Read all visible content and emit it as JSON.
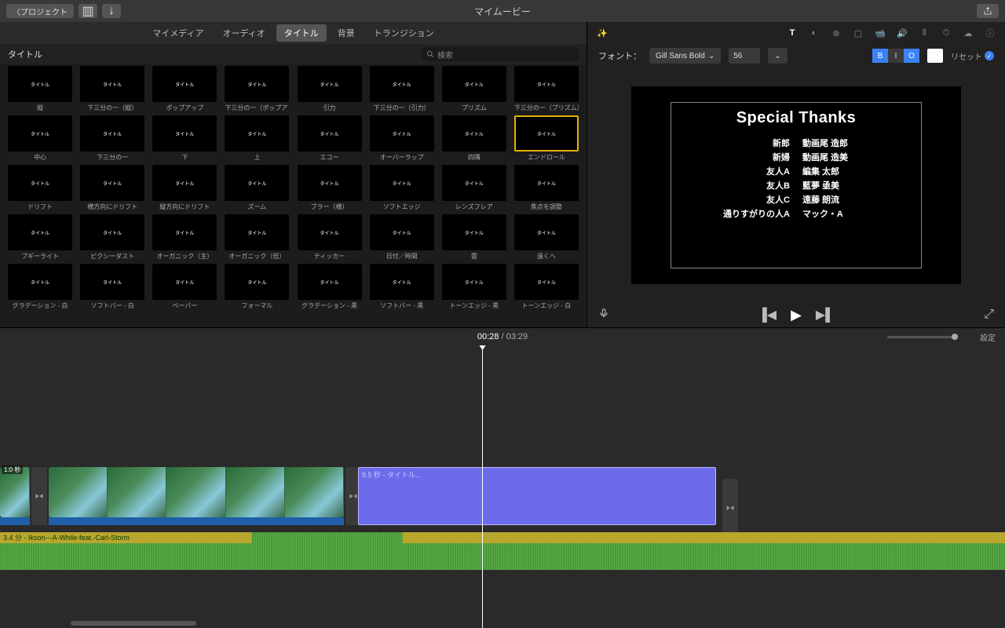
{
  "app": {
    "title": "マイムービー",
    "back": "プロジェクト"
  },
  "browser": {
    "tabs": [
      "マイメディア",
      "オーディオ",
      "タイトル",
      "背景",
      "トランジション"
    ],
    "activeTab": 2,
    "section": "タイトル",
    "search_placeholder": "検索",
    "titles": [
      {
        "label": "縦"
      },
      {
        "label": "下三分の一（縦）"
      },
      {
        "label": "ポップアップ"
      },
      {
        "label": "下三分の一（ポップアップ）"
      },
      {
        "label": "引力"
      },
      {
        "label": "下三分の一（引力）"
      },
      {
        "label": "プリズム"
      },
      {
        "label": "下三分の一（プリズム）"
      },
      {
        "label": "中心"
      },
      {
        "label": "下三分の一"
      },
      {
        "label": "下"
      },
      {
        "label": "上"
      },
      {
        "label": "エコー"
      },
      {
        "label": "オーバーラップ"
      },
      {
        "label": "四隅"
      },
      {
        "label": "エンドロール",
        "selected": true
      },
      {
        "label": "ドリフト"
      },
      {
        "label": "横方向にドリフト"
      },
      {
        "label": "縦方向にドリフト"
      },
      {
        "label": "ズーム"
      },
      {
        "label": "ブラー（横）"
      },
      {
        "label": "ソフトエッジ"
      },
      {
        "label": "レンズフレア"
      },
      {
        "label": "焦点を調整"
      },
      {
        "label": "ブギーライト"
      },
      {
        "label": "ピクシーダスト"
      },
      {
        "label": "オーガニック（主）"
      },
      {
        "label": "オーガニック（低）"
      },
      {
        "label": "ティッカー"
      },
      {
        "label": "日付／時間"
      },
      {
        "label": "雲"
      },
      {
        "label": "遠くへ"
      },
      {
        "label": "グラデーション - 白"
      },
      {
        "label": "ソフトバー - 白"
      },
      {
        "label": "ペーパー"
      },
      {
        "label": "フォーマル"
      },
      {
        "label": "グラデーション - 黒"
      },
      {
        "label": "ソフトバー - 黒"
      },
      {
        "label": "トーンエッジ - 黒"
      },
      {
        "label": "トーンエッジ - 白"
      }
    ]
  },
  "inspector": {
    "font_label": "フォント：",
    "font_family": "Gill Sans Bold",
    "font_size": "56",
    "bold": "B",
    "italic": "I",
    "outline": "O",
    "reset": "リセット"
  },
  "credits": {
    "heading": "Special Thanks",
    "rows": [
      {
        "role": "新郎",
        "name": "動画尾 造郎"
      },
      {
        "role": "新婦",
        "name": "動画尾 造美"
      },
      {
        "role": "友人A",
        "name": "編集 太郎"
      },
      {
        "role": "友人B",
        "name": "藍夢 亟美"
      },
      {
        "role": "友人C",
        "name": "遠藤 朗流"
      },
      {
        "role": "通りすがりの人A",
        "name": "マック・A"
      }
    ]
  },
  "timeline": {
    "current": "00:28",
    "total": "03:29",
    "settings": "設定",
    "video_clip_tag": "1:0 秒",
    "title_clip": "8.5 秒 - タイトル...",
    "audio_clip": "3.4 分 - Ikson---A-While-feat.-Carl-Storm"
  }
}
